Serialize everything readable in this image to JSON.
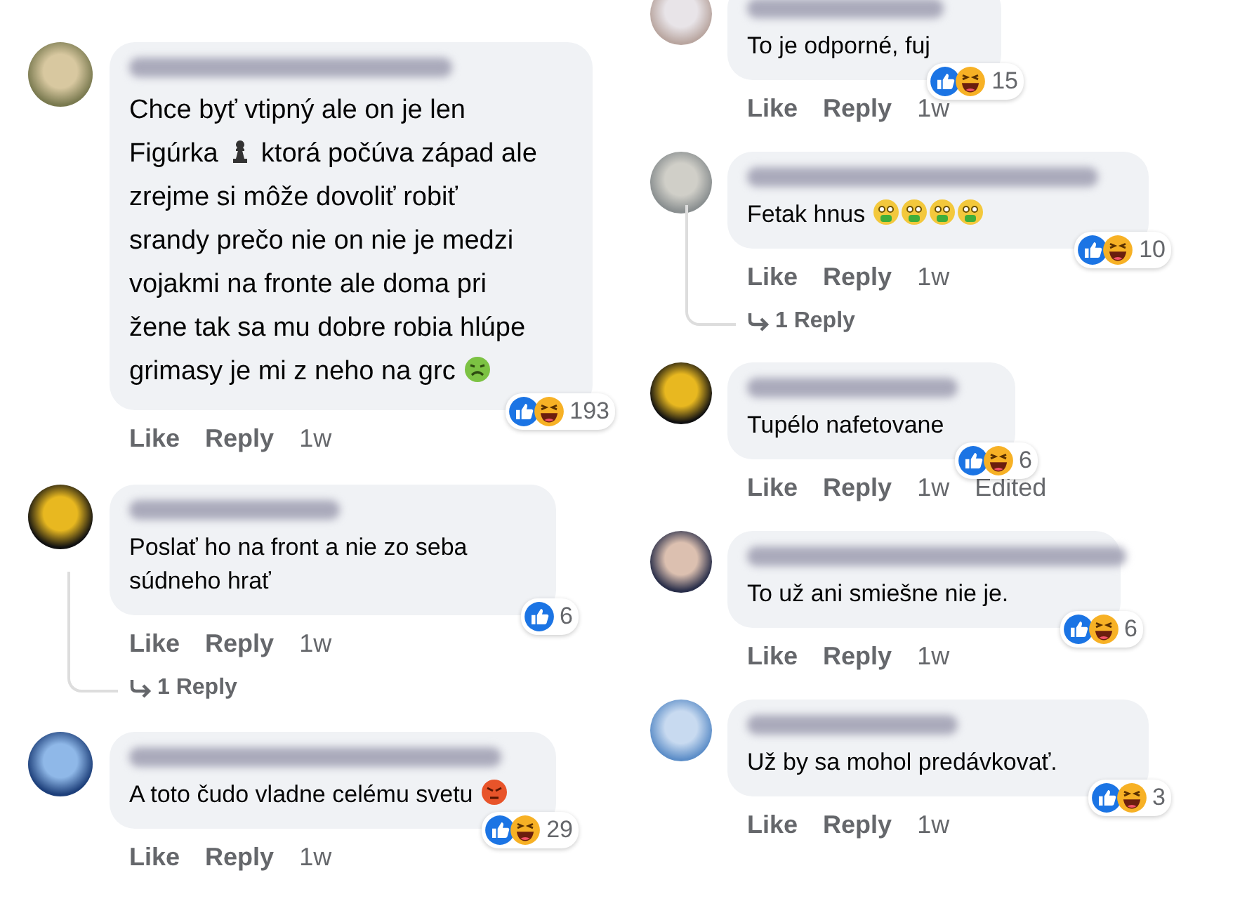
{
  "columns": [
    {
      "comments": [
        {
          "body": [
            {
              "kind": "text",
              "text": "Chce byť vtipný ale on je len Figúrka "
            },
            {
              "kind": "pawn"
            },
            {
              "kind": "text",
              "text": " ktorá počúva západ ale zrejme si môže dovoliť robiť srandy prečo nie on nie je medzi vojakmi na fronte ale doma pri žene tak sa mu dobre robia hlúpe grimasy je mi z neho na grc "
            },
            {
              "kind": "nauseated"
            }
          ],
          "reactions": [
            {
              "kind": "like"
            },
            {
              "kind": "haha"
            }
          ],
          "count": "193",
          "actions": [
            "Like",
            "Reply"
          ],
          "time": "1w"
        },
        {
          "body": [
            {
              "kind": "text",
              "text": "Poslať ho na front a nie zo seba súdneho hrať"
            }
          ],
          "reactions": [
            {
              "kind": "like"
            }
          ],
          "count": "6",
          "actions": [
            "Like",
            "Reply"
          ],
          "time": "1w",
          "replies": "1 Reply"
        },
        {
          "body": [
            {
              "kind": "text",
              "text": "A toto čudo vladne celému svetu "
            },
            {
              "kind": "angry"
            }
          ],
          "reactions": [
            {
              "kind": "like"
            },
            {
              "kind": "haha"
            }
          ],
          "count": "29",
          "actions": [
            "Like",
            "Reply"
          ],
          "time": "1w"
        }
      ]
    },
    {
      "comments": [
        {
          "body": [
            {
              "kind": "text",
              "text": "To je odporné, fuj"
            }
          ],
          "reactions": [
            {
              "kind": "like"
            },
            {
              "kind": "haha"
            }
          ],
          "count": "15",
          "actions": [
            "Like",
            "Reply"
          ],
          "time": "1w"
        },
        {
          "body": [
            {
              "kind": "text",
              "text": "Fetak hnus "
            },
            {
              "kind": "vomit"
            },
            {
              "kind": "vomit"
            },
            {
              "kind": "vomit"
            },
            {
              "kind": "vomit"
            }
          ],
          "reactions": [
            {
              "kind": "like"
            },
            {
              "kind": "haha"
            }
          ],
          "count": "10",
          "actions": [
            "Like",
            "Reply"
          ],
          "time": "1w",
          "replies": "1 Reply"
        },
        {
          "body": [
            {
              "kind": "text",
              "text": "Tupélo nafetovane"
            }
          ],
          "reactions": [
            {
              "kind": "like"
            },
            {
              "kind": "haha"
            }
          ],
          "count": "6",
          "actions": [
            "Like",
            "Reply"
          ],
          "time": "1w",
          "edited": "Edited"
        },
        {
          "body": [
            {
              "kind": "text",
              "text": "To už ani smiešne nie je."
            }
          ],
          "reactions": [
            {
              "kind": "like"
            },
            {
              "kind": "haha"
            }
          ],
          "count": "6",
          "actions": [
            "Like",
            "Reply"
          ],
          "time": "1w"
        },
        {
          "body": [
            {
              "kind": "text",
              "text": "Už by sa mohol predávkovať."
            }
          ],
          "reactions": [
            {
              "kind": "like"
            },
            {
              "kind": "haha"
            }
          ],
          "count": "3",
          "actions": [
            "Like",
            "Reply"
          ],
          "time": "1w"
        }
      ]
    }
  ]
}
